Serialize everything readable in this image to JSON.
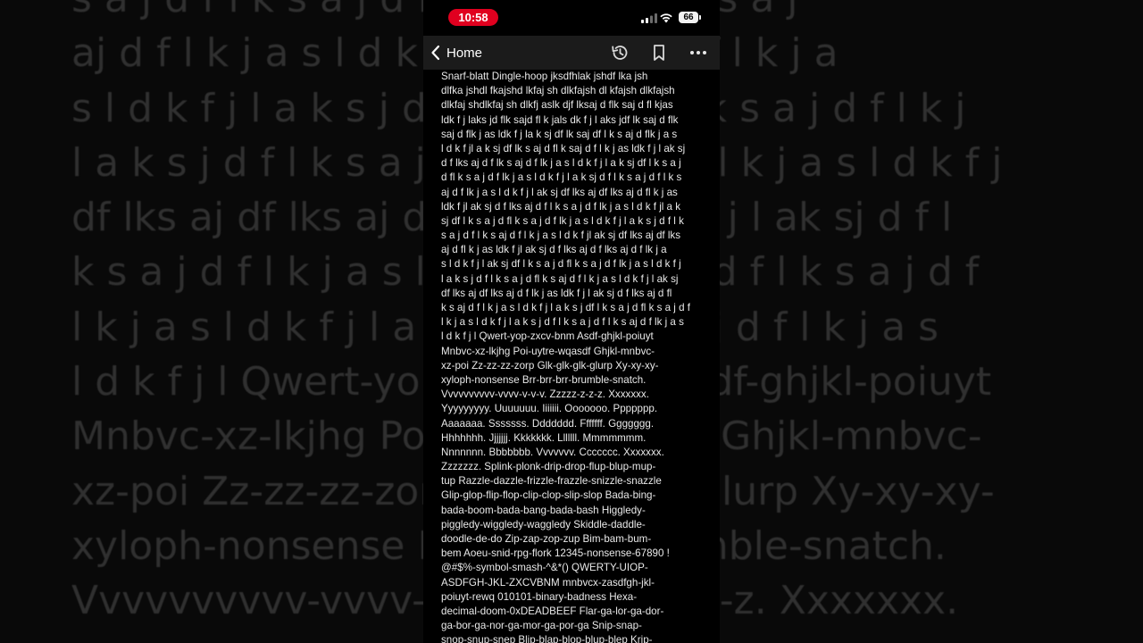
{
  "status_bar": {
    "time": "10:58",
    "battery": "66"
  },
  "nav": {
    "back_label": "Home",
    "icons": [
      "history-icon",
      "bookmark-icon",
      "more-icon"
    ]
  },
  "document": {
    "lines": [
      "Snarf-blatt Dingle-hoop jksdfhlak jshdf lka jsh",
      "dlfka jshdl fkajshd lkfaj sh dlkfajsh dl kfajsh dlkfajsh",
      "dlkfaj shdlkfaj sh dlkfj aslk djf lksaj d flk saj d fl kjas",
      "ldk f j laks jd flk sajd fl k jals dk f j l aks jdf lk saj d flk",
      "saj d flk j as ldk f j la k sj df lk saj df l k s aj d flk j a s",
      "l d k f jl a k sj df lk s aj d fl k saj d f l k j as ldk f j l ak sj",
      "d f lks aj d f lk s aj d f lk j a s l d k f j l a k sj df l k s a j",
      "d fl k s a j d f lk j a s l d k f j l a k sj d f l k s a j d f l k s",
      "aj d f lk j a s l d k f j l ak sj df lks aj df lks aj d fl k j as",
      "ldk f jl ak sj d f lks aj d f l k s a j d f lk j a s l d k f jl a k",
      "sj df l k s a j d fl k s a j d f lk j a s l d k f j l a k s j d f l k",
      "s a j d f l k s aj d f l k j a s l d k f jl ak sj df lks aj df lks",
      "aj d fl k j as ldk f jl ak sj d f lks aj d f lks aj d f lk j a",
      "s l d k f j l ak sj df l k s a j d fl k s a j d f lk j a s l d k f j",
      "l a k s j d f l k s a j d fl k s aj d f l k j a s l d k f j l ak sj",
      "df lks aj df lks aj d f lk j as ldk f j l ak sj d f lks aj d fl",
      "k s aj d f l k j a s l d k f j l a k s j df l k s a j d fl k s a j d f",
      "l k j a s l d k f j l a k s j d f l k s a j d f l k s aj d f lk j a s",
      "l d k f j l Qwert-yop-zxcv-bnm Asdf-ghjkl-poiuyt",
      "Mnbvc-xz-lkjhg Poi-uytre-wqasdf Ghjkl-mnbvc-",
      "xz-poi Zz-zz-zz-zorp Glk-glk-glk-glurp Xy-xy-xy-",
      "xyloph-nonsense Brr-brr-brr-brumble-snatch.",
      "Vvvvvvvvvv-vvvv-v-v-v. Zzzzz-z-z-z. Xxxxxxx.",
      "Yyyyyyyyy. Uuuuuuu. Iiiiiii. Ooooooo. Ppppppp.",
      "Aaaaaaa. Sssssss. Ddddddd. Fffffff. Ggggggg.",
      "Hhhhhhh. Jjjjjjj. Kkkkkkk. Lllllll. Mmmmmmm.",
      "Nnnnnnn. Bbbbbbb. Vvvvvvv. Ccccccc. Xxxxxxx.",
      "Zzzzzzz.  Splink-plonk-drip-drop-flup-blup-mup-",
      "tup Razzle-dazzle-frizzle-frazzle-snizzle-snazzle",
      "Glip-glop-flip-flop-clip-clop-slip-slop Bada-bing-",
      "bada-boom-bada-bang-bada-bash Higgledy-",
      "piggledy-wiggledy-waggledy Skiddle-daddle-",
      "doodle-de-do Zip-zap-zop-zup Bim-bam-bum-",
      "bem Aoeu-snid-rpg-flork 12345-nonsense-67890 !",
      "@#$%-symbol-smash-^&*() QWERTY-UIOP-",
      "ASDFGH-JKL-ZXCVBNM mnbvcx-zasdfgh-jkl-",
      "poiuyt-rewq 010101-binary-badness Hexa-",
      "decimal-doom-0xDEADBEEF Flar-ga-lor-ga-dor-",
      "ga-bor-ga-nor-ga-mor-ga-por-ga Snip-snap-",
      "snop-snup-snep Blip-blap-blop-blup-blep Krip-"
    ]
  },
  "background_text": {
    "lines": [
      "s a j d f l k s a j d f l k s a j d f l k s a j",
      "aj d f l k j a s l d k f j l a k s a j d f l k j a",
      "s l d k f j l a k s j d f l k s a j d f l k s a j d f l k j",
      "l a k s j d f l k s a j d f l k s a j d f l k j a s l d k f j",
      "df lks aj df lks aj d f lk j a s l d k f j l ak sj d f l",
      "k s a j d f l k j a s l d k f j l a k s j d f l k s a j d f",
      "l k j a s l d k f j l a k s j d f l k s a j d f l k j a s",
      "l d k f j l Qwert-yop-zxcv-bnm Asdf-ghjkl-poiuyt",
      "Mnbvc-xz-lkjhg Poi-uytre-wqasdf Ghjkl-mnbvc-",
      "xz-poi Zz-zz-zz-zorp Glk-glk-glk-glurp Xy-xy-xy-",
      "xyloph-nonsense Brr-brr-brr-brumble-snatch.",
      "Vvvvvvvvvv-vvvv-v-v-v. Zzzzz-z-z-z. Xxxxxxx."
    ]
  },
  "colors": {
    "time_pill": "#e0001f",
    "page_background": "#000000",
    "nav_background": "#1b1b1b",
    "text": "#e9e9e9"
  }
}
